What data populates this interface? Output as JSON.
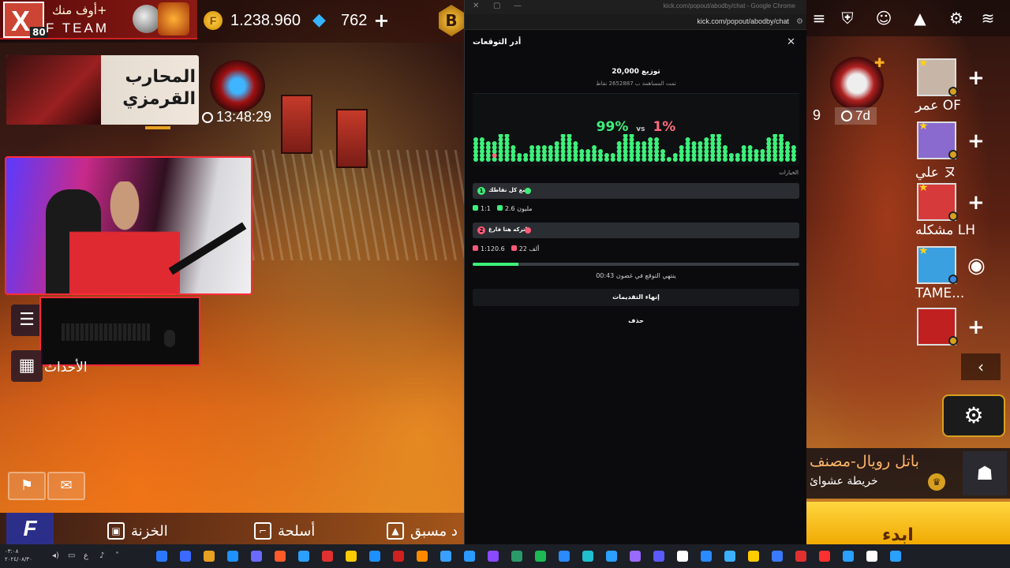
{
  "game": {
    "team": {
      "label": "أوف منك+",
      "name": "F TEAM",
      "level": "80",
      "avatar_letter": "X"
    },
    "currency": {
      "coins": "1.238.960",
      "coin_symbol": "F",
      "diamonds": "762",
      "plus": "+"
    },
    "badge_letter": "B",
    "event_banner_title": "المحارب القرمزي",
    "event_timer": "13:48:29",
    "events_label": "الأحداث",
    "nav": {
      "vault": "الخزنة",
      "weapons": "أسلحة",
      "advance": "د مسبق",
      "logo": "F"
    },
    "right": {
      "days_partial": "9",
      "days": "7d",
      "friends": [
        {
          "name": "عمر OF",
          "color": "#c7b6a8"
        },
        {
          "name": "علي ヌ",
          "color": "#8a6acf"
        },
        {
          "name": "مشكله LH",
          "color": "#d63a3a"
        },
        {
          "name": "TAME...",
          "color": "#3aa0e0"
        },
        {
          "name": "",
          "color": "#c02020"
        }
      ],
      "mode_title": "باتل رويال-مصنف",
      "mode_sub": "خريطة عشوائ",
      "start_label": "ابدء"
    }
  },
  "chrome": {
    "window_title": "kick.com/popout/abodby/chat - Google Chrome",
    "url": "kick.com/popout/abodby/chat"
  },
  "prediction": {
    "panel_title": "أدر التوقعات",
    "close_icon": "✕",
    "distribution_title": "توزيع 20,000",
    "distribution_sub": "تمت المساهمة ب 2652887 نقاط",
    "percent_green": "99%",
    "vs": "vs",
    "percent_red": "1%",
    "options_label": "الخيارات",
    "options": [
      {
        "number": "1",
        "text": "ضع كل نقاطك",
        "color": "#3df07a",
        "ratio": "1:1",
        "amount": "2.6 مليون"
      },
      {
        "number": "2",
        "text": "اتركه هنا فارغ",
        "color": "#ff5a7a",
        "ratio": "1:120.6",
        "amount": "22 ألف"
      }
    ],
    "progress": 0.14,
    "timer_text": "00:43 ينتهي التوقع في غضون",
    "end_button": "إنهاء التقديمات",
    "delete_button": "حذف"
  },
  "taskbar": {
    "clock_time": "٠٣:٠٨",
    "clock_date": "٢٠٢٤/٠٨/٣٠",
    "lang": "ع"
  }
}
